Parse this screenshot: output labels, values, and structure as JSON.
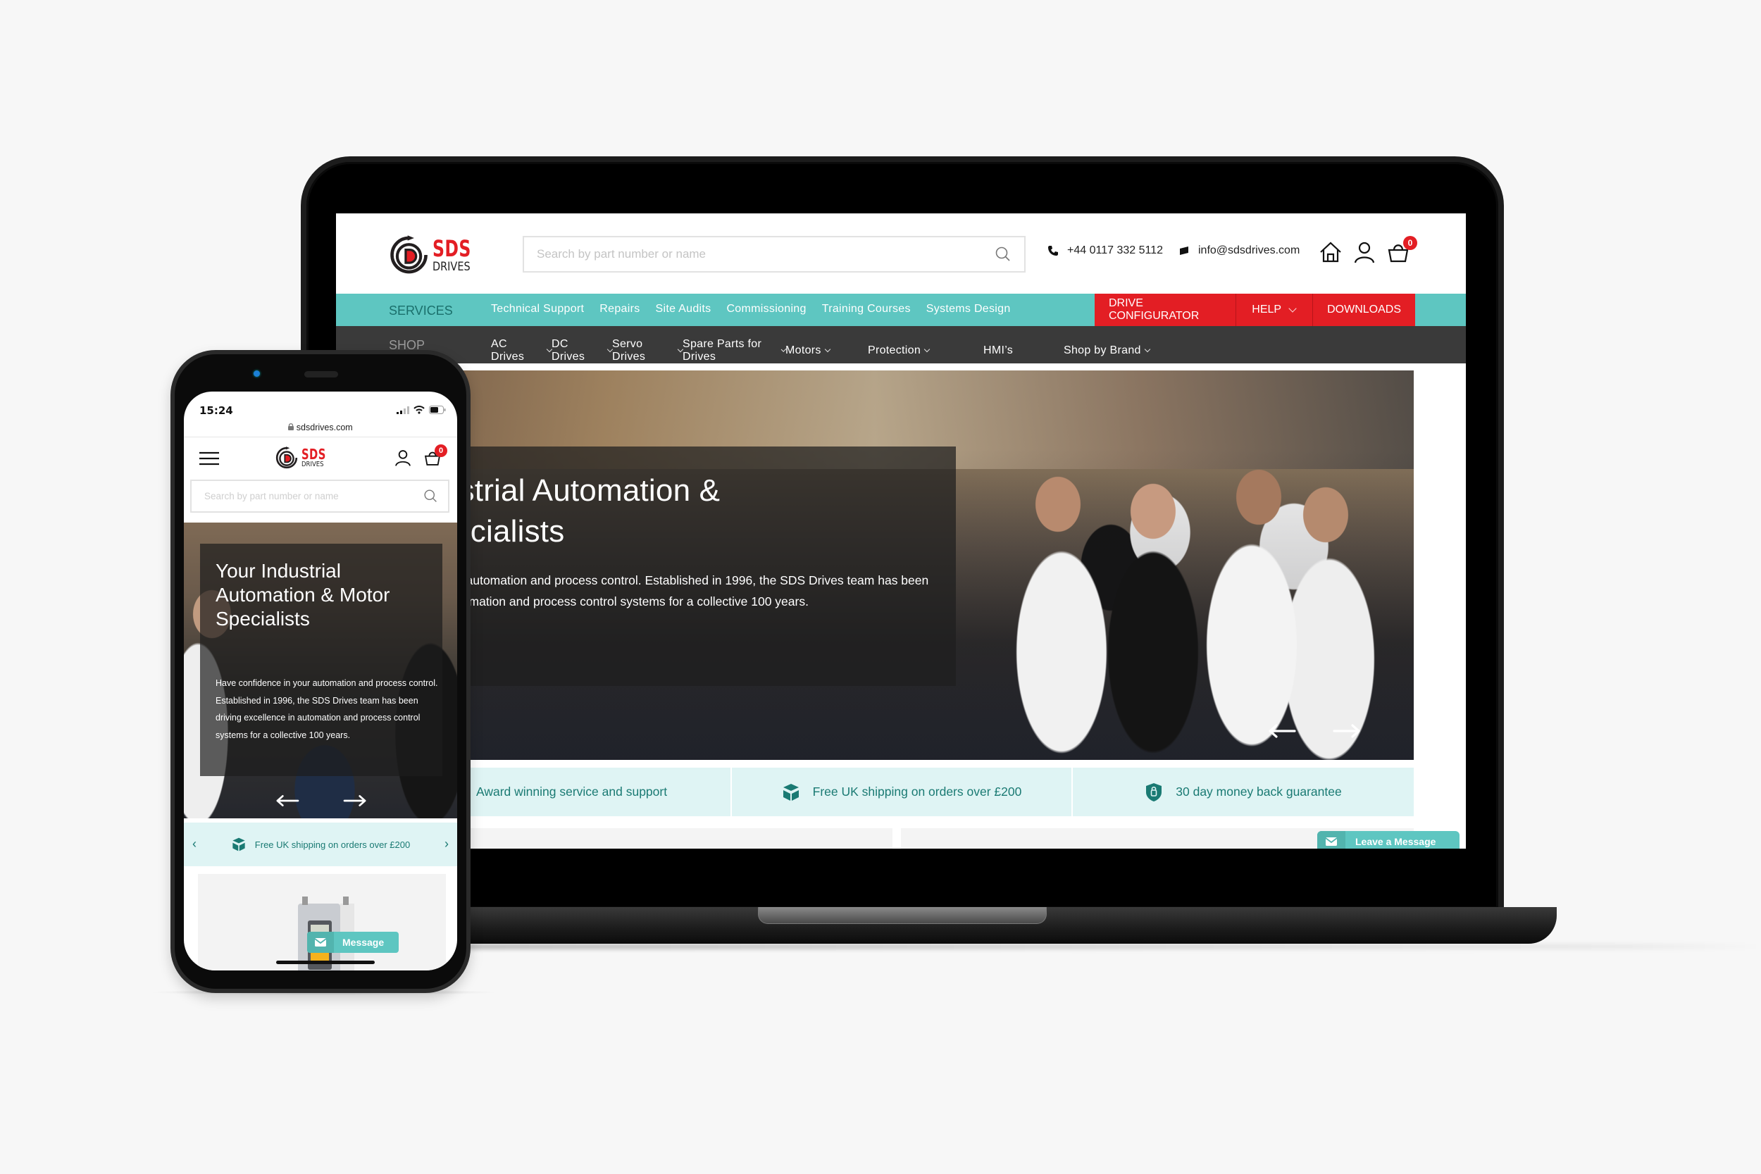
{
  "desktop": {
    "brand": {
      "name": "SDS",
      "sub": "DRIVES",
      "accent": "#e31e24",
      "teal": "#5ec6c1"
    },
    "search": {
      "placeholder": "Search by part number or name"
    },
    "contact": {
      "phone": "+44 0117 332 5112",
      "email": "info@sdsdrives.com"
    },
    "icons": {
      "home": "home-icon",
      "account": "user-icon",
      "basket": "basket-icon"
    },
    "basket_count": "0",
    "services_nav": {
      "label": "SERVICES",
      "items": [
        "Technical Support",
        "Repairs",
        "Site Audits",
        "Commissioning",
        "Training Courses",
        "Systems Design"
      ]
    },
    "actions": {
      "configurator": "DRIVE CONFIGURATOR",
      "help": "HELP",
      "downloads": "DOWNLOADS"
    },
    "shop_nav": {
      "label": "SHOP",
      "items": [
        {
          "label": "AC Drives",
          "dropdown": true
        },
        {
          "label": "DC Drives",
          "dropdown": true
        },
        {
          "label": "Servo Drives",
          "dropdown": true
        },
        {
          "label": "Spare Parts for Drives",
          "dropdown": true
        },
        {
          "label": "Motors",
          "dropdown": true
        },
        {
          "label": "Protection",
          "dropdown": true
        },
        {
          "label": "HMI’s",
          "dropdown": false
        },
        {
          "label": "Shop by Brand",
          "dropdown": true
        }
      ]
    },
    "hero": {
      "title_line1": "Your Industrial Automation &",
      "title_line2": "Motor Specialists",
      "body": "Have confidence in your automation and process control. Established in 1996, the SDS Drives team has been driving excellence in automation and process control systems for a collective 100 years."
    },
    "trust": [
      {
        "icon": "award-icon",
        "text": "Award winning service and support"
      },
      {
        "icon": "box-icon",
        "text": "Free UK shipping on orders over £200"
      },
      {
        "icon": "shield-icon",
        "text": "30 day money back guarantee"
      }
    ],
    "chat": {
      "label": "Leave a Message"
    }
  },
  "mobile": {
    "status": {
      "time": "15:24",
      "url": "sdsdrives.com"
    },
    "search": {
      "placeholder": "Search by part number or name"
    },
    "basket_count": "0",
    "hero": {
      "title": "Your Industrial Automation & Motor Specialists",
      "body": "Have confidence in your automation and process control. Established in 1996, the SDS Drives team has been driving excellence in automation and process control systems for a collective 100 years."
    },
    "trust": {
      "text": "Free UK shipping on orders over £200",
      "prev": "‹",
      "next": "›"
    },
    "chat": {
      "label": "Message"
    }
  }
}
